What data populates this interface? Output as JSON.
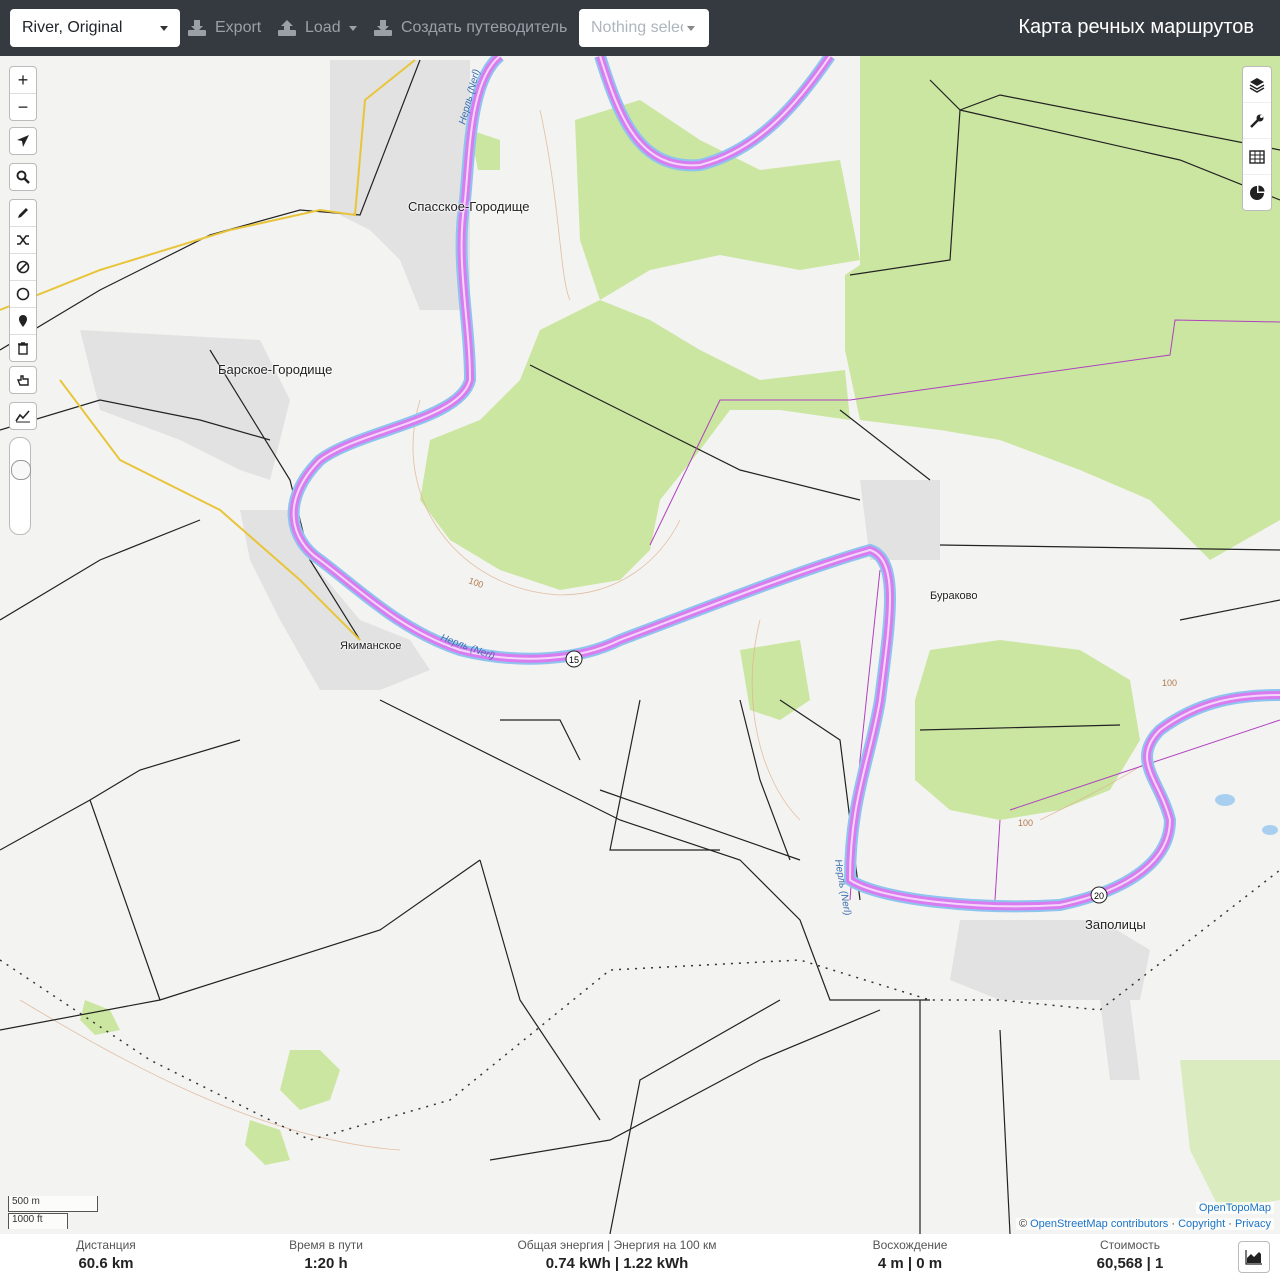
{
  "toolbar": {
    "profile": "River, Original",
    "export_label": "Export",
    "load_label": "Load",
    "create_guide_label": "Создать путеводитель",
    "selection_placeholder": "Nothing selected",
    "app_title": "Карта речных маршрутов"
  },
  "map": {
    "places": [
      "Спасское-Городище",
      "Барское-Городище",
      "Якиманское",
      "Бураково",
      "Заполицы"
    ],
    "river_label": "Нерль (Nerl)",
    "route_markers": [
      "15",
      "20"
    ],
    "contour_label": "100",
    "scale_metric": "500 m",
    "scale_imperial": "1000 ft",
    "attribution_top": "OpenTopoMap",
    "attribution_bottom_prefix": "©",
    "attribution_osm": "OpenStreetMap contributors",
    "attribution_copyright": "Copyright",
    "attribution_privacy": "Privacy",
    "colors": {
      "route": "#d97cf0",
      "river": "#a8cff0",
      "forest": "#cbe6a0",
      "roads": "#222222"
    }
  },
  "left_controls": {
    "zoom_in": "+",
    "zoom_out": "−",
    "icons": [
      "locate-icon",
      "search-icon",
      "draw-icon",
      "shuffle-icon",
      "no-entry-icon",
      "circle-icon",
      "pin-icon",
      "trash-icon",
      "hand-icon",
      "elevation-icon"
    ]
  },
  "right_controls": {
    "icons": [
      "layers-icon",
      "wrench-icon",
      "table-icon",
      "pie-chart-icon"
    ]
  },
  "stats": {
    "distance": {
      "label": "Дистанция",
      "value": "60.6 km"
    },
    "time": {
      "label": "Время в пути",
      "value": "1:20 h"
    },
    "energy": {
      "label": "Общая энергия | Энергия на 100 км",
      "value": "0.74 kWh | 1.22 kWh"
    },
    "ascent": {
      "label": "Восхождение",
      "value": "4 m | 0 m"
    },
    "cost": {
      "label": "Стоимость",
      "value": "60,568 | 1"
    }
  }
}
